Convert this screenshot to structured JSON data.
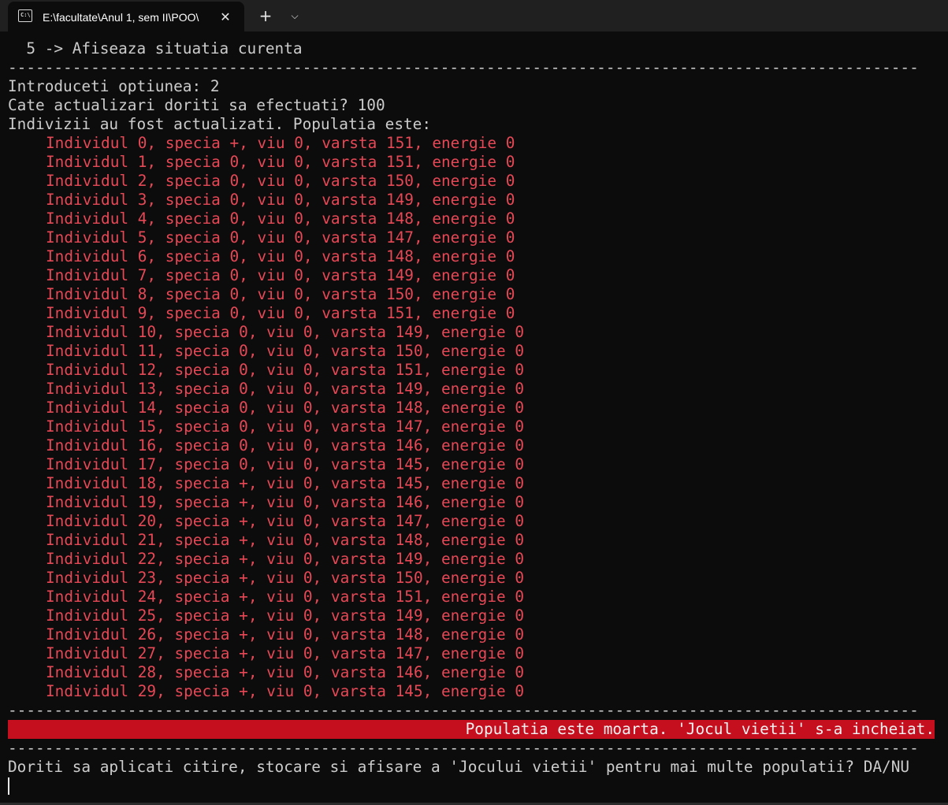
{
  "tabbar": {
    "tab_title": "E:\\facultate\\Anul 1, sem II\\POO\\",
    "tab_icon_glyph": "C:\\",
    "close_glyph": "✕",
    "new_tab_glyph": "+",
    "dropdown_glyph": "⌵"
  },
  "terminal": {
    "menu_line": "  5 -> Afiseaza situatia curenta",
    "separator": "---------------------------------------------------------------------------------------------------",
    "option_prompt": "Introduceti optiunea: 2",
    "updates_prompt": "Cate actualizari doriti sa efectuati? 100",
    "updated_msg": "Indivizii au fost actualizati. Populatia este:",
    "individuals": [
      "Individul 0, specia +, viu 0, varsta 151, energie 0",
      "Individul 1, specia 0, viu 0, varsta 151, energie 0",
      "Individul 2, specia 0, viu 0, varsta 150, energie 0",
      "Individul 3, specia 0, viu 0, varsta 149, energie 0",
      "Individul 4, specia 0, viu 0, varsta 148, energie 0",
      "Individul 5, specia 0, viu 0, varsta 147, energie 0",
      "Individul 6, specia 0, viu 0, varsta 148, energie 0",
      "Individul 7, specia 0, viu 0, varsta 149, energie 0",
      "Individul 8, specia 0, viu 0, varsta 150, energie 0",
      "Individul 9, specia 0, viu 0, varsta 151, energie 0",
      "Individul 10, specia 0, viu 0, varsta 149, energie 0",
      "Individul 11, specia 0, viu 0, varsta 150, energie 0",
      "Individul 12, specia 0, viu 0, varsta 151, energie 0",
      "Individul 13, specia 0, viu 0, varsta 149, energie 0",
      "Individul 14, specia 0, viu 0, varsta 148, energie 0",
      "Individul 15, specia 0, viu 0, varsta 147, energie 0",
      "Individul 16, specia 0, viu 0, varsta 146, energie 0",
      "Individul 17, specia 0, viu 0, varsta 145, energie 0",
      "Individul 18, specia +, viu 0, varsta 145, energie 0",
      "Individul 19, specia +, viu 0, varsta 146, energie 0",
      "Individul 20, specia +, viu 0, varsta 147, energie 0",
      "Individul 21, specia +, viu 0, varsta 148, energie 0",
      "Individul 22, specia +, viu 0, varsta 149, energie 0",
      "Individul 23, specia +, viu 0, varsta 150, energie 0",
      "Individul 24, specia +, viu 0, varsta 151, energie 0",
      "Individul 25, specia +, viu 0, varsta 149, energie 0",
      "Individul 26, specia +, viu 0, varsta 148, energie 0",
      "Individul 27, specia +, viu 0, varsta 147, energie 0",
      "Individul 28, specia +, viu 0, varsta 146, energie 0",
      "Individul 29, specia +, viu 0, varsta 145, energie 0"
    ],
    "banner": "Populatia este moarta. 'Jocul vietii' s-a incheiat.",
    "final_prompt": "Doriti sa aplicati citire, stocare si afisare a 'Jocului vietii' pentru mai multe populatii? DA/NU"
  },
  "colors": {
    "background": "#0c0c0c",
    "text": "#cccccc",
    "individual_text": "#e74856",
    "banner_bg": "#c50f1f",
    "tabbar_bg": "#202020"
  }
}
